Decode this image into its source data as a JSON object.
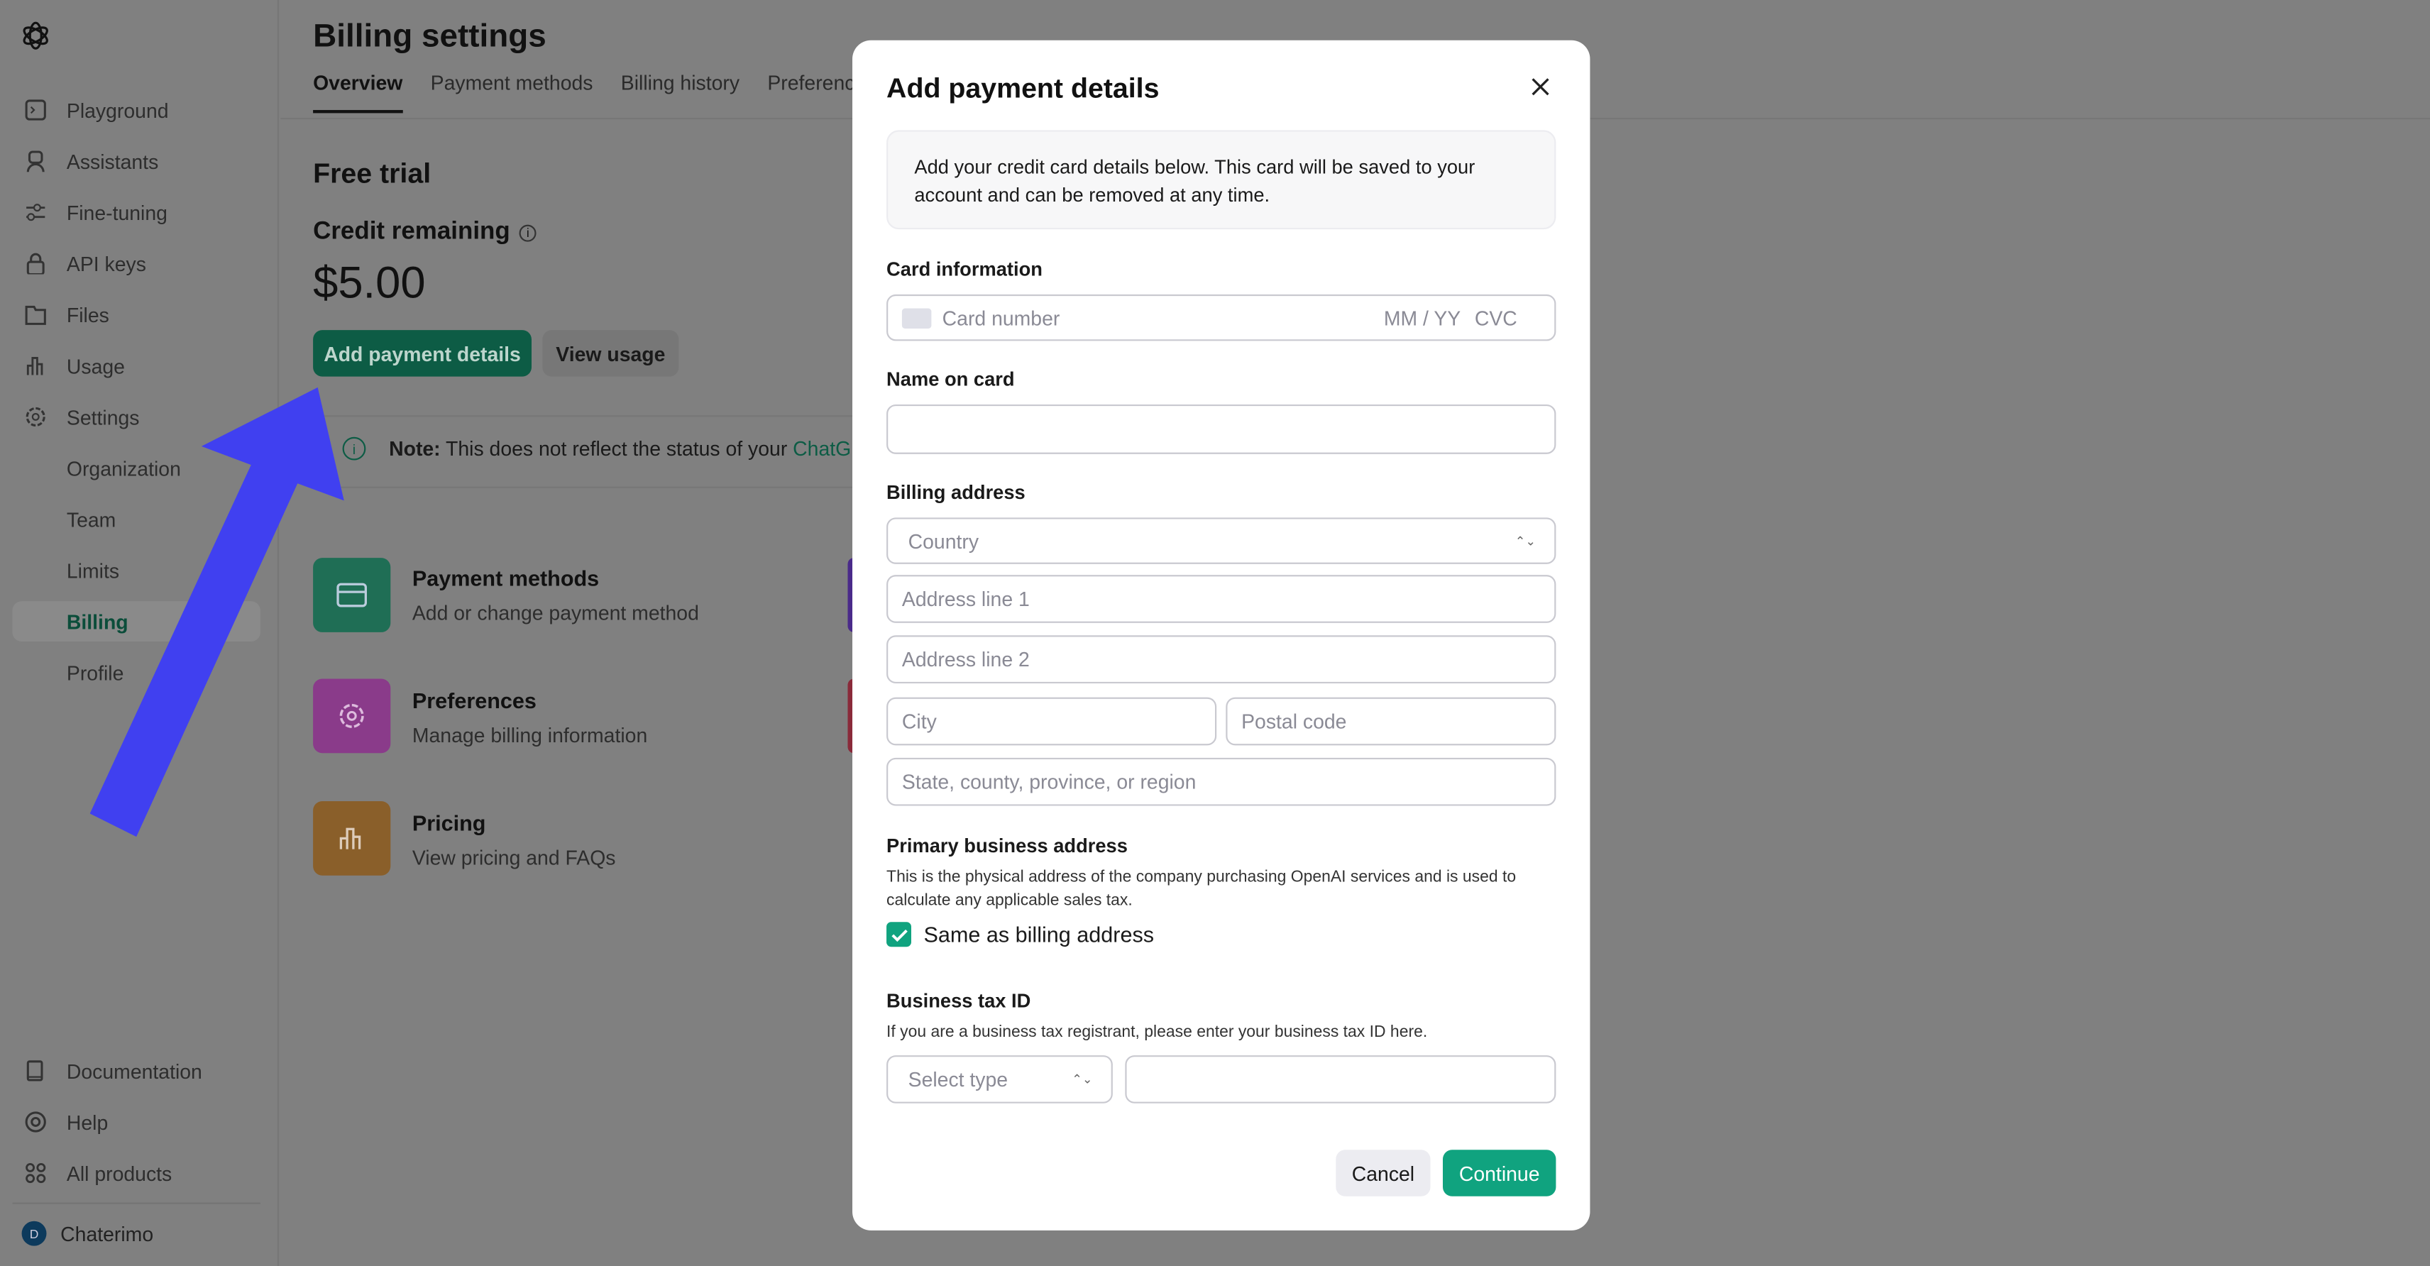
{
  "sidebar": {
    "items": [
      {
        "label": "Playground",
        "icon": "terminal-icon"
      },
      {
        "label": "Assistants",
        "icon": "robot-icon"
      },
      {
        "label": "Fine-tuning",
        "icon": "sliders-icon"
      },
      {
        "label": "API keys",
        "icon": "lock-icon"
      },
      {
        "label": "Files",
        "icon": "folder-icon"
      },
      {
        "label": "Usage",
        "icon": "bar-chart-icon"
      },
      {
        "label": "Settings",
        "icon": "gear-icon"
      }
    ],
    "sub_items": [
      {
        "label": "Organization"
      },
      {
        "label": "Team"
      },
      {
        "label": "Limits"
      },
      {
        "label": "Billing",
        "active": true
      },
      {
        "label": "Profile"
      }
    ],
    "bottom": [
      {
        "label": "Documentation",
        "icon": "book-icon"
      },
      {
        "label": "Help",
        "icon": "lifebuoy-icon"
      },
      {
        "label": "All products",
        "icon": "grid-icon"
      }
    ],
    "user": {
      "initial": "D",
      "name": "Chaterimo"
    }
  },
  "main": {
    "title": "Billing settings",
    "tabs": [
      {
        "label": "Overview",
        "active": true
      },
      {
        "label": "Payment methods"
      },
      {
        "label": "Billing history"
      },
      {
        "label": "Preferences"
      }
    ],
    "plan": "Free trial",
    "credit_label": "Credit remaining",
    "credit_value": "$5.00",
    "add_payment_label": "Add payment details",
    "view_usage_label": "View usage",
    "note_bold": "Note:",
    "note_text": " This does not reflect the status of your ",
    "note_link": "ChatGPT",
    "cards": [
      {
        "title": "Payment methods",
        "desc": "Add or change payment method",
        "color": "#1f6e55",
        "icon": "credit-card-icon"
      },
      {
        "title": "Preferences",
        "desc": "Manage billing information",
        "color": "#8a3b8a",
        "icon": "gear-icon"
      },
      {
        "title": "Pricing",
        "desc": "View pricing and FAQs",
        "color": "#8a5f2a",
        "icon": "bar-chart-icon"
      }
    ]
  },
  "modal": {
    "title": "Add payment details",
    "info": "Add your credit card details below. This card will be saved to your account and can be removed at any time.",
    "card_label": "Card information",
    "card_placeholder": "Card number",
    "expiry_placeholder": "MM / YY",
    "cvc_placeholder": "CVC",
    "name_label": "Name on card",
    "billing_label": "Billing address",
    "country_placeholder": "Country",
    "address1_placeholder": "Address line 1",
    "address2_placeholder": "Address line 2",
    "city_placeholder": "City",
    "postal_placeholder": "Postal code",
    "state_placeholder": "State, county, province, or region",
    "primary_label": "Primary business address",
    "primary_desc": "This is the physical address of the company purchasing OpenAI services and is used to calculate any applicable sales tax.",
    "same_as_billing": "Same as billing address",
    "same_checked": true,
    "tax_label": "Business tax ID",
    "tax_desc": "If you are a business tax registrant, please enter your business tax ID here.",
    "tax_type_placeholder": "Select type",
    "cancel_label": "Cancel",
    "continue_label": "Continue"
  },
  "colors": {
    "accent": "#10a37f",
    "arrow": "#4040f0",
    "overlay": "#808080"
  }
}
